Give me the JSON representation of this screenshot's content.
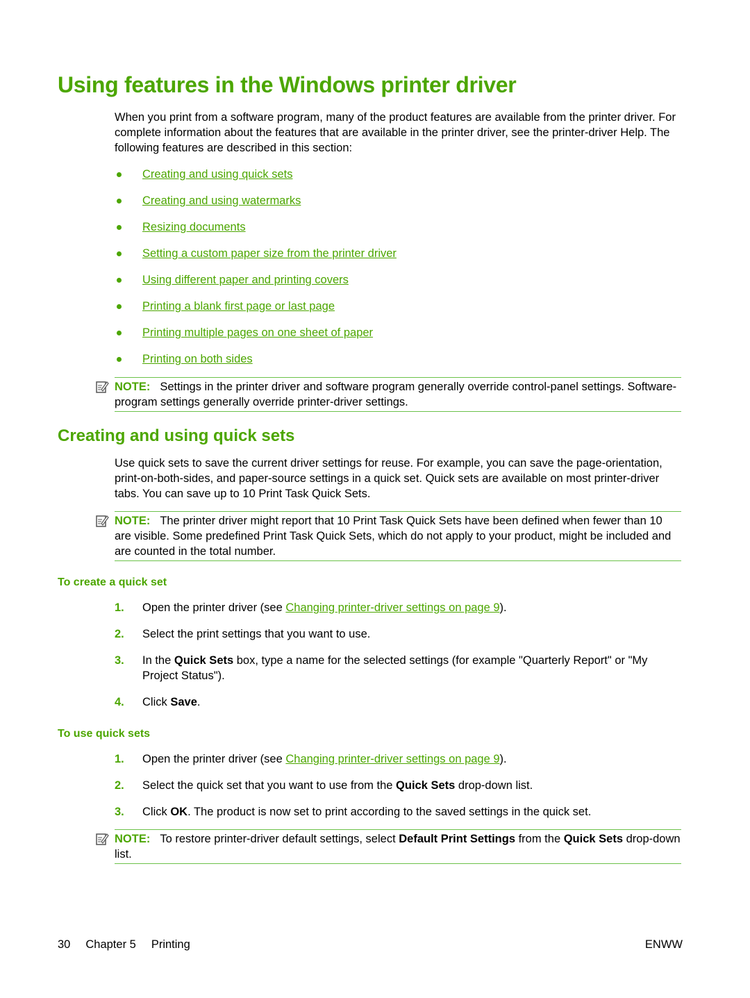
{
  "title": "Using features in the Windows printer driver",
  "intro": "When you print from a software program, many of the product features are available from the printer driver. For complete information about the features that are available in the printer driver, see the printer-driver Help. The following features are described in this section:",
  "feature_links": [
    "Creating and using quick sets",
    "Creating and using watermarks",
    "Resizing documents",
    "Setting a custom paper size from the printer driver",
    "Using different paper and printing covers",
    "Printing a blank first page or last page",
    "Printing multiple pages on one sheet of paper",
    "Printing on both sides"
  ],
  "note_label": "NOTE:",
  "note1": "Settings in the printer driver and software program generally override control-panel settings. Software-program settings generally override printer-driver settings.",
  "section": {
    "title": "Creating and using quick sets",
    "body": "Use quick sets to save the current driver settings for reuse. For example, you can save the page-orientation, print-on-both-sides, and paper-source settings in a quick set. Quick sets are available on most printer-driver tabs. You can save up to 10 Print Task Quick Sets.",
    "note2": "The printer driver might report that 10 Print Task Quick Sets have been defined when fewer than 10 are visible. Some predefined Print Task Quick Sets, which do not apply to your product, might be included and are counted in the total number."
  },
  "create": {
    "heading": "To create a quick set",
    "steps": [
      {
        "num": "1.",
        "pre": "Open the printer driver (see ",
        "link": "Changing printer-driver settings on page 9",
        "post": ")."
      },
      {
        "num": "2.",
        "text": "Select the print settings that you want to use."
      },
      {
        "num": "3.",
        "pre": "In the ",
        "bold": "Quick Sets",
        "post": " box, type a name for the selected settings (for example \"Quarterly Report\" or \"My Project Status\")."
      },
      {
        "num": "4.",
        "pre": "Click ",
        "bold": "Save",
        "post": "."
      }
    ]
  },
  "use": {
    "heading": "To use quick sets",
    "steps": [
      {
        "num": "1.",
        "pre": "Open the printer driver (see ",
        "link": "Changing printer-driver settings on page 9",
        "post": ")."
      },
      {
        "num": "2.",
        "pre": "Select the quick set that you want to use from the ",
        "bold": "Quick Sets",
        "post": " drop-down list."
      },
      {
        "num": "3.",
        "pre": "Click ",
        "bold": "OK",
        "post": ". The product is now set to print according to the saved settings in the quick set."
      }
    ]
  },
  "note3": {
    "pre": "To restore printer-driver default settings, select ",
    "bold1": "Default Print Settings",
    "mid": " from the ",
    "bold2": "Quick Sets",
    "post": " drop-down list."
  },
  "footer": {
    "page": "30",
    "chapter": "Chapter 5",
    "section": "Printing",
    "right": "ENWW"
  }
}
